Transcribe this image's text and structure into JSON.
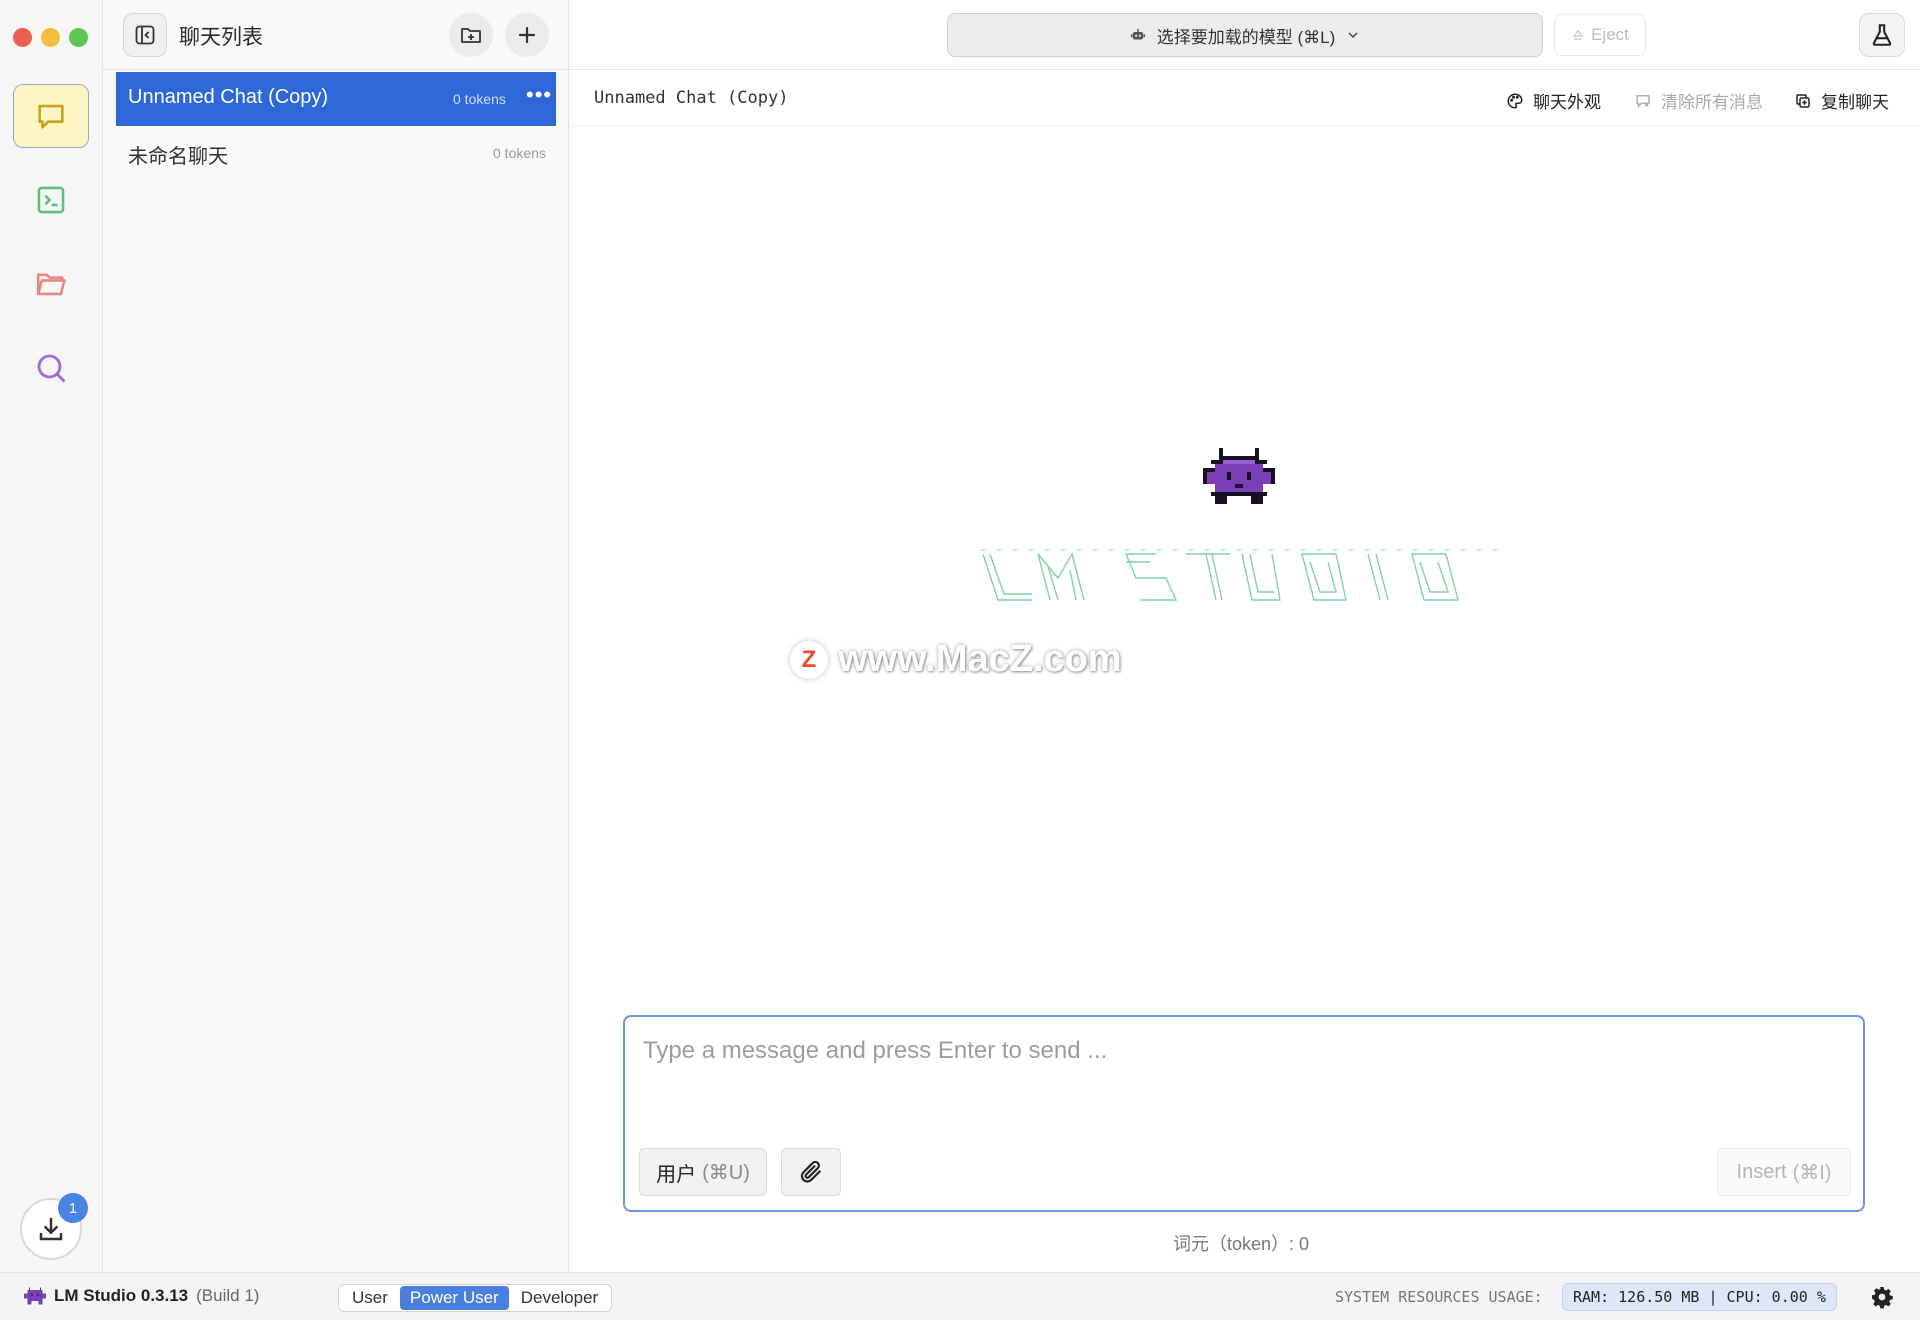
{
  "colors": {
    "accent": "#2e68d8",
    "rail_active_bg": "#fbf5c3",
    "ascii_logo": "#7fd3a8",
    "mascot": "#7a3fb5"
  },
  "panel": {
    "title": "聊天列表",
    "chats": [
      {
        "name": "Unnamed Chat (Copy)",
        "tokens": "0 tokens",
        "selected": true
      },
      {
        "name": "未命名聊天",
        "tokens": "0 tokens",
        "selected": false
      }
    ]
  },
  "topbar": {
    "model_selector": "选择要加载的模型  (⌘L)",
    "eject": "Eject"
  },
  "subbar": {
    "chat_title": "Unnamed Chat (Copy)",
    "appearance": "聊天外观",
    "clear": "清除所有消息",
    "duplicate": "复制聊天"
  },
  "watermark": {
    "badge": "Z",
    "text": "www.MacZ.com"
  },
  "composer": {
    "placeholder": "Type a message and press Enter to send ...",
    "role_label": "用户",
    "role_shortcut": "(⌘U)",
    "insert_label": "Insert",
    "insert_shortcut": "(⌘I)"
  },
  "token_count": "词元（token）: 0",
  "rail": {
    "download_badge": "1"
  },
  "statusbar": {
    "app_name": "LM Studio 0.3.13",
    "build": "(Build 1)",
    "modes": [
      "User",
      "Power User",
      "Developer"
    ],
    "active_mode": "Power User",
    "sys_label": "SYSTEM RESOURCES USAGE:",
    "sys_value": "RAM: 126.50 MB  |  CPU: 0.00 %"
  }
}
